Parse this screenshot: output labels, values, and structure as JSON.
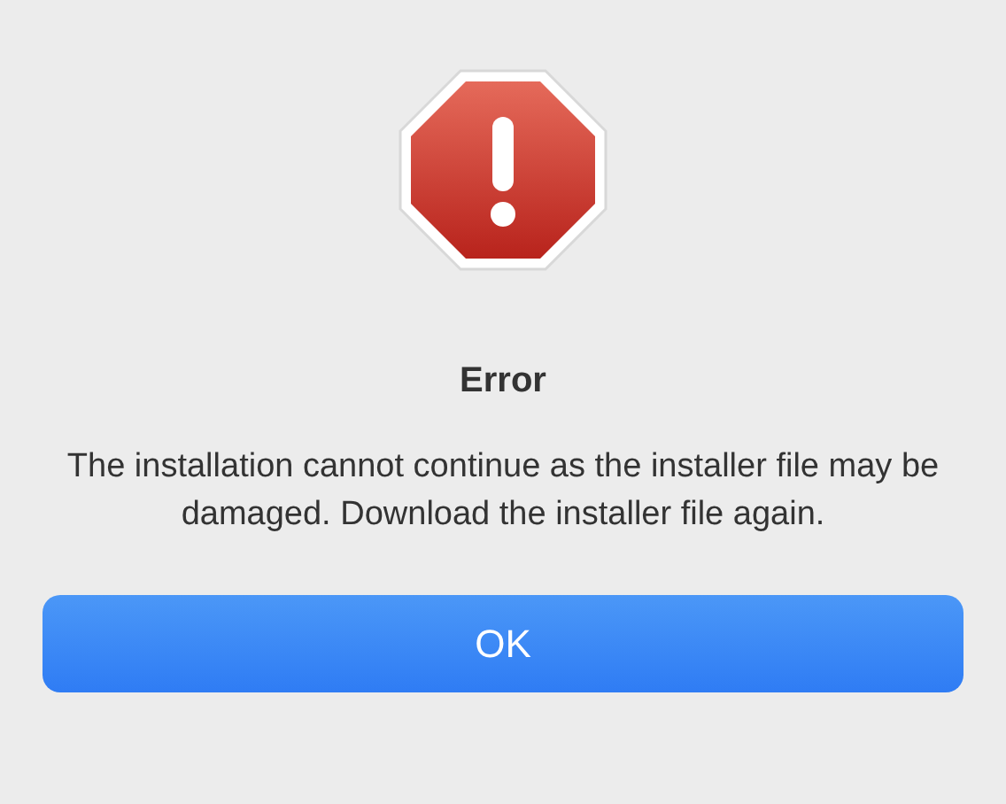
{
  "dialog": {
    "title": "Error",
    "message": "The installation cannot continue as the installer file may be damaged. Download the installer file again.",
    "buttons": [
      "OK"
    ]
  }
}
